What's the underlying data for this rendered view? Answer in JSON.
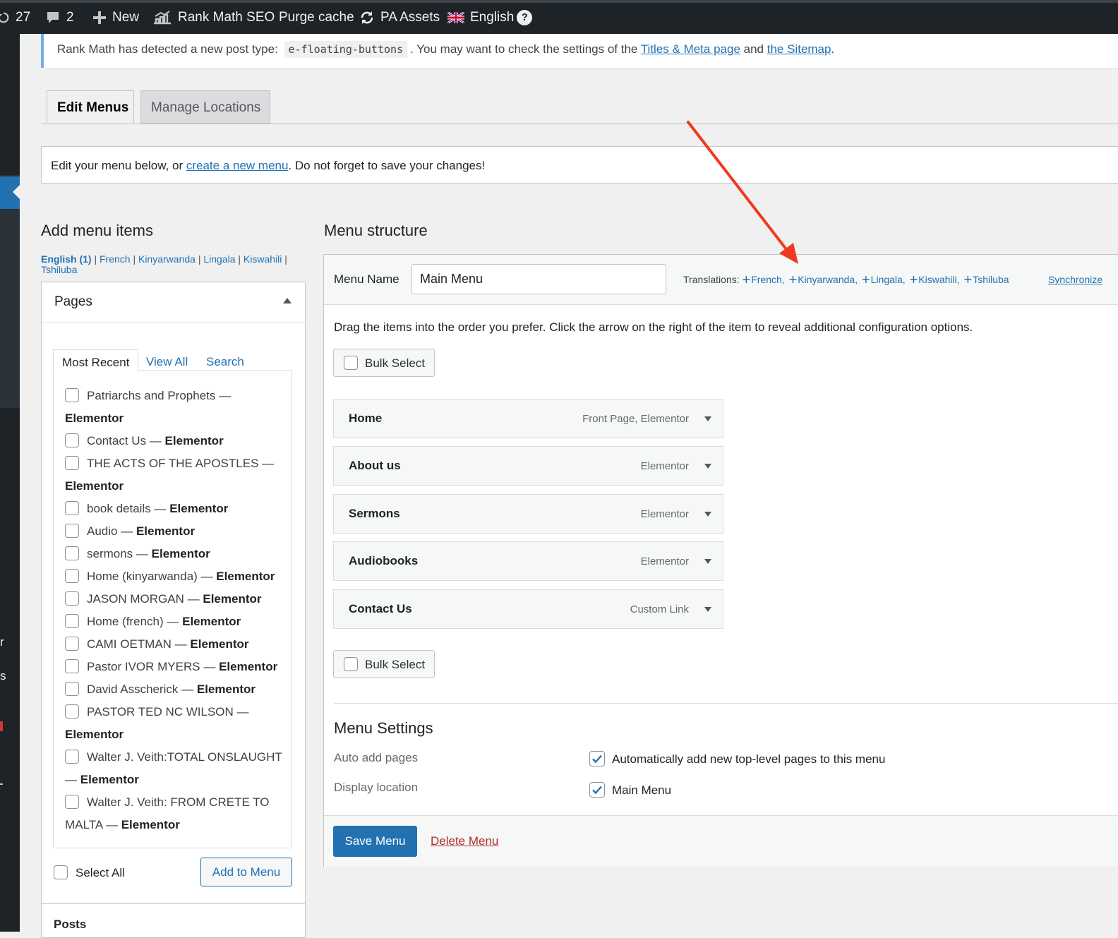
{
  "adminbar": {
    "updates": "27",
    "comments": "2",
    "new": "New",
    "rankmath": "Rank Math SEO",
    "purge": "Purge cache",
    "pa_assets": "PA Assets",
    "language": "English",
    "help": "?"
  },
  "sidebar_fragments": [
    "r",
    "s"
  ],
  "notice": {
    "text_before": "Rank Math has detected a new post type:",
    "code": "e-floating-buttons",
    "text_middle": ". You may want to check the settings of the",
    "link1": "Titles & Meta page",
    "and": "and",
    "link2": "the Sitemap",
    "end": "."
  },
  "tabs": {
    "edit": "Edit Menus",
    "manage": "Manage Locations"
  },
  "manage_notice": {
    "before": "Edit your menu below, or",
    "link": "create a new menu",
    "after": ". Do not forget to save your changes!"
  },
  "add_menu_items": {
    "title": "Add menu items",
    "languages": [
      {
        "label": "English (1)",
        "current": true
      },
      {
        "label": "French"
      },
      {
        "label": "Kinyarwanda"
      },
      {
        "label": "Lingala"
      },
      {
        "label": "Kiswahili"
      },
      {
        "label": "Tshiluba"
      }
    ],
    "separator": "|",
    "pages_title": "Pages",
    "tabs": [
      "Most Recent",
      "View All",
      "Search"
    ],
    "pages": [
      {
        "title": "Patriarchs and Prophets —",
        "builder": "Elementor"
      },
      {
        "title": "Contact Us —",
        "builder": "Elementor"
      },
      {
        "title": "THE ACTS OF THE APOSTLES —",
        "builder": "Elementor"
      },
      {
        "title": "book details —",
        "builder": "Elementor"
      },
      {
        "title": "Audio —",
        "builder": "Elementor"
      },
      {
        "title": "sermons —",
        "builder": "Elementor"
      },
      {
        "title": "Home (kinyarwanda) —",
        "builder": "Elementor"
      },
      {
        "title": "JASON MORGAN —",
        "builder": "Elementor"
      },
      {
        "title": "Home (french) —",
        "builder": "Elementor"
      },
      {
        "title": "CAMI OETMAN —",
        "builder": "Elementor"
      },
      {
        "title": "Pastor IVOR MYERS —",
        "builder": "Elementor"
      },
      {
        "title": "David Asscherick —",
        "builder": "Elementor"
      },
      {
        "title": "PASTOR TED NC WILSON —",
        "builder": "Elementor"
      },
      {
        "title": "Walter J. Veith:TOTAL ONSLAUGHT —",
        "builder": "Elementor"
      },
      {
        "title": "Walter J. Veith: FROM CRETE TO MALTA —",
        "builder": "Elementor"
      }
    ],
    "select_all": "Select All",
    "add_to_menu": "Add to Menu",
    "posts_title": "Posts"
  },
  "menu_structure": {
    "title": "Menu structure",
    "menu_name_label": "Menu Name",
    "menu_name_value": "Main Menu",
    "translations_label": "Translations:",
    "translations": [
      "French,",
      "Kinyarwanda,",
      "Lingala,",
      "Kiswahili,",
      "Tshiluba"
    ],
    "synchronize": "Synchronize",
    "instructions": "Drag the items into the order you prefer. Click the arrow on the right of the item to reveal additional configuration options.",
    "bulk_select": "Bulk Select",
    "items": [
      {
        "title": "Home",
        "type": "Front Page, Elementor"
      },
      {
        "title": "About us",
        "type": "Elementor"
      },
      {
        "title": "Sermons",
        "type": "Elementor"
      },
      {
        "title": "Audiobooks",
        "type": "Elementor"
      },
      {
        "title": "Contact Us",
        "type": "Custom Link"
      }
    ],
    "settings_title": "Menu Settings",
    "auto_add_label": "Auto add pages",
    "auto_add_value": "Automatically add new top-level pages to this menu",
    "auto_add_checked": true,
    "display_location_label": "Display location",
    "display_location_value": "Main Menu",
    "display_location_checked": true,
    "save": "Save Menu",
    "delete": "Delete Menu"
  },
  "colors": {
    "accent": "#2271b1",
    "adminbar": "#1d2327",
    "delete": "#b32d2e",
    "annotation_arrow": "#f0391e"
  }
}
